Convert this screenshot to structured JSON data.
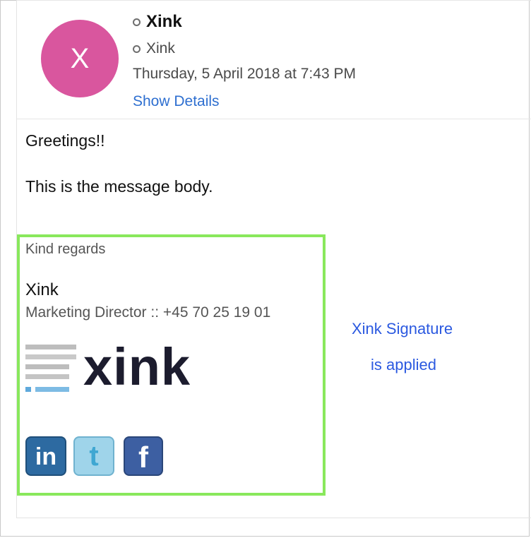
{
  "sender": {
    "avatar_letter": "X",
    "name": "Xink"
  },
  "recipient": {
    "name": "Xink"
  },
  "date": "Thursday, 5 April 2018 at 7:43 PM",
  "show_details": "Show Details",
  "message": {
    "greeting": "Greetings!!",
    "body": "This is the message body."
  },
  "signature": {
    "closing": "Kind regards",
    "name": "Xink",
    "title_phone": "Marketing Director :: +45 70 25 19 01",
    "logo_text": "xink",
    "social": {
      "linkedin": "in",
      "twitter": "t",
      "facebook": "f"
    }
  },
  "annotation": {
    "line1": "Xink Signature",
    "line2": "is applied"
  },
  "colors": {
    "avatar": "#d9569e",
    "link": "#2e6fd0",
    "highlight_border": "#89e85c",
    "annotation": "#2b59e0",
    "logo_dark": "#1c1c2e",
    "logo_bar_accent": "#5fa9dc"
  },
  "icons": [
    "status-ring-icon",
    "linkedin-icon",
    "twitter-icon",
    "facebook-icon"
  ]
}
